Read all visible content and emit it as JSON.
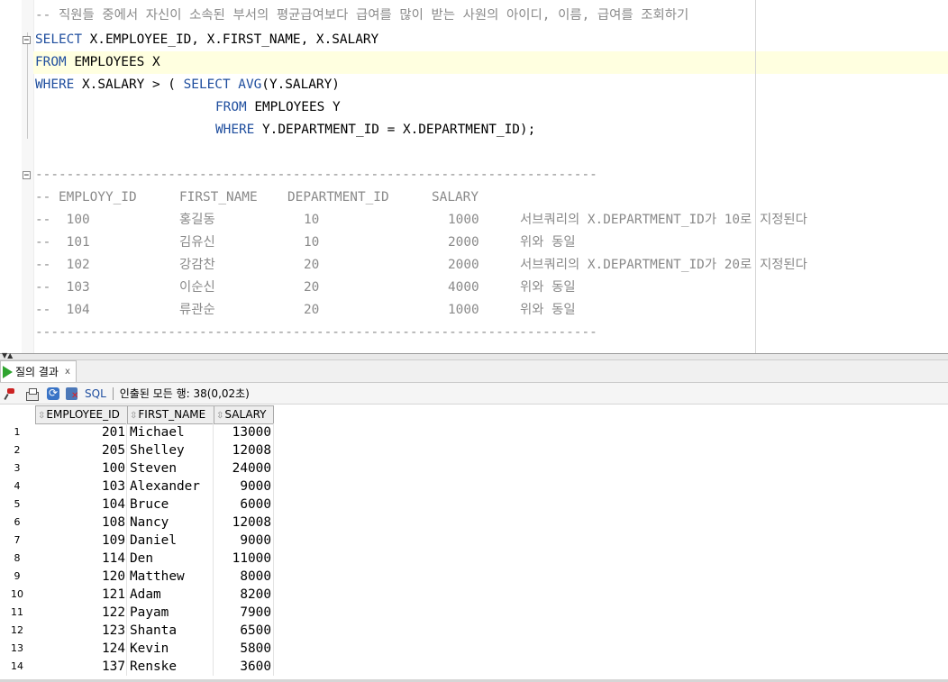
{
  "editor": {
    "comment_line": "-- 직원들 중에서 자신이 소속된 부서의 평균급여보다 급여를 많이 받는 사원의 아이디, 이름, 급여를 조회하기",
    "line1": {
      "kw": "SELECT",
      "rest": " X.EMPLOYEE_ID, X.FIRST_NAME, X.SALARY"
    },
    "line2": {
      "kw": "FROM",
      "rest": " EMPLOYEES X"
    },
    "line3": {
      "kw1": "WHERE",
      "mid": " X.SALARY > ( ",
      "kw2": "SELECT",
      "kw3": "AVG",
      "rest": "(Y.SALARY)"
    },
    "line4": {
      "kw": "FROM",
      "rest": " EMPLOYEES Y"
    },
    "line5": {
      "kw": "WHERE",
      "rest": " Y.DEPARTMENT_ID = X.DEPARTMENT_ID);"
    },
    "separator": "------------------------------------------------------------------------",
    "table_header": {
      "c1": "-- EMPLOYY_ID",
      "c2": "FIRST_NAME",
      "c3": "DEPARTMENT_ID",
      "c4": "SALARY"
    },
    "table_rows": [
      {
        "id": "--  100",
        "name": "홍길동",
        "dept": "10",
        "salary": "1000",
        "note": "서브쿼리의 X.DEPARTMENT_ID가 10로 지정된다"
      },
      {
        "id": "--  101",
        "name": "김유신",
        "dept": "10",
        "salary": "2000",
        "note": "위와 동일"
      },
      {
        "id": "--  102",
        "name": "강감찬",
        "dept": "20",
        "salary": "2000",
        "note": "서브쿼리의 X.DEPARTMENT_ID가 20로 지정된다"
      },
      {
        "id": "--  103",
        "name": "이순신",
        "dept": "20",
        "salary": "4000",
        "note": "위와 동일"
      },
      {
        "id": "--  104",
        "name": "류관순",
        "dept": "20",
        "salary": "1000",
        "note": "위와 동일"
      }
    ],
    "colors": {
      "keyword": "#1f4e9e",
      "comment": "#8a8a8a",
      "current_line": "#ffffe0"
    }
  },
  "results": {
    "tab_label": "질의 결과",
    "tab_close": "x",
    "sql_label": "SQL",
    "fetched_text": "인출된 모든 행: 38(0,02초)",
    "columns": [
      "EMPLOYEE_ID",
      "FIRST_NAME",
      "SALARY"
    ],
    "rows": [
      {
        "n": "1",
        "id": "201",
        "name": "Michael",
        "salary": "13000"
      },
      {
        "n": "2",
        "id": "205",
        "name": "Shelley",
        "salary": "12008"
      },
      {
        "n": "3",
        "id": "100",
        "name": "Steven",
        "salary": "24000"
      },
      {
        "n": "4",
        "id": "103",
        "name": "Alexander",
        "salary": "9000"
      },
      {
        "n": "5",
        "id": "104",
        "name": "Bruce",
        "salary": "6000"
      },
      {
        "n": "6",
        "id": "108",
        "name": "Nancy",
        "salary": "12008"
      },
      {
        "n": "7",
        "id": "109",
        "name": "Daniel",
        "salary": "9000"
      },
      {
        "n": "8",
        "id": "114",
        "name": "Den",
        "salary": "11000"
      },
      {
        "n": "9",
        "id": "120",
        "name": "Matthew",
        "salary": "8000"
      },
      {
        "n": "10",
        "id": "121",
        "name": "Adam",
        "salary": "8200"
      },
      {
        "n": "11",
        "id": "122",
        "name": "Payam",
        "salary": "7900"
      },
      {
        "n": "12",
        "id": "123",
        "name": "Shanta",
        "salary": "6500"
      },
      {
        "n": "13",
        "id": "124",
        "name": "Kevin",
        "salary": "5800"
      },
      {
        "n": "14",
        "id": "137",
        "name": "Renske",
        "salary": "3600"
      }
    ]
  }
}
